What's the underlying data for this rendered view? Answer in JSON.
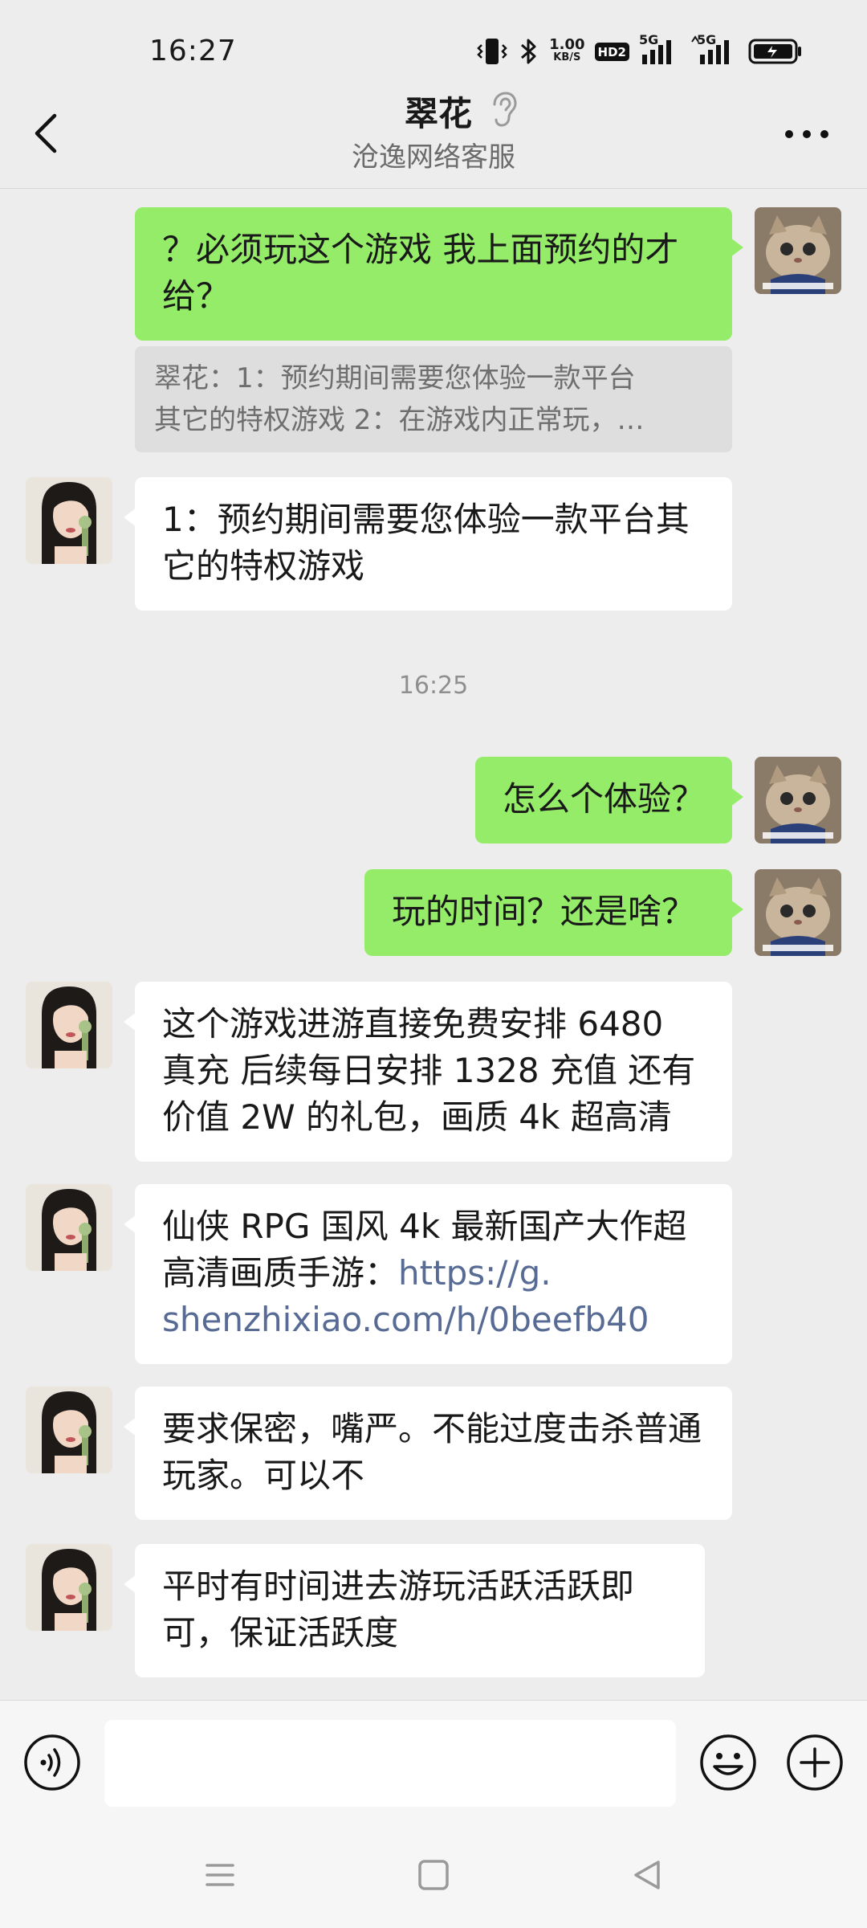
{
  "status_bar": {
    "time": "16:27",
    "net_speed": "1.00",
    "net_unit": "KB/S",
    "hd_label": "HD2",
    "signal_1_label": "5G",
    "signal_2_label": "5G",
    "battery": "battery-charging"
  },
  "header": {
    "title": "翠花",
    "subtitle": "沧逸网络客服",
    "icons": [
      "back-icon",
      "ear-icon",
      "more-icon"
    ]
  },
  "messages": [
    {
      "from": "me",
      "text": "？必须玩这个游戏 我上面预约的才给？"
    },
    {
      "type": "quote",
      "line1": "翠花：1：预约期间需要您体验一款平台",
      "line2": "其它的特权游戏 2：在游戏内正常玩，…"
    },
    {
      "from": "them",
      "text": "1：预约期间需要您体验一款平台其它的特权游戏"
    },
    {
      "type": "timestamp",
      "text": "16:25"
    },
    {
      "from": "me",
      "text": "怎么个体验？"
    },
    {
      "from": "me",
      "text": "玩的时间？还是啥？"
    },
    {
      "from": "them",
      "text": "这个游戏进游直接免费安排 6480 真充 后续每日安排 1328 充值 还有价值 2W 的礼包，画质 4k 超高清"
    },
    {
      "from": "them",
      "text_before": "仙侠 RPG 国风 4k 最新国产大作超高清画质手游：",
      "link_line1": "https://g.",
      "link_line2": "shenzhixiao.com/h/0beefb40"
    },
    {
      "from": "them",
      "text": "要求保密，嘴严。不能过度击杀普通玩家。可以不"
    },
    {
      "from": "them",
      "text": "平时有时间进去游玩活跃活跃即可，保证活跃度"
    }
  ],
  "colors": {
    "background": "#ededed",
    "my_bubble": "#95ec69",
    "their_bubble": "#ffffff",
    "link": "#576b95"
  },
  "input_bar": {
    "value": "",
    "placeholder": "",
    "icons": [
      "voice-icon",
      "emoji-icon",
      "plus-icon"
    ]
  },
  "nav_bar": {
    "icons": [
      "menu-icon",
      "home-icon",
      "back-triangle-icon"
    ]
  }
}
